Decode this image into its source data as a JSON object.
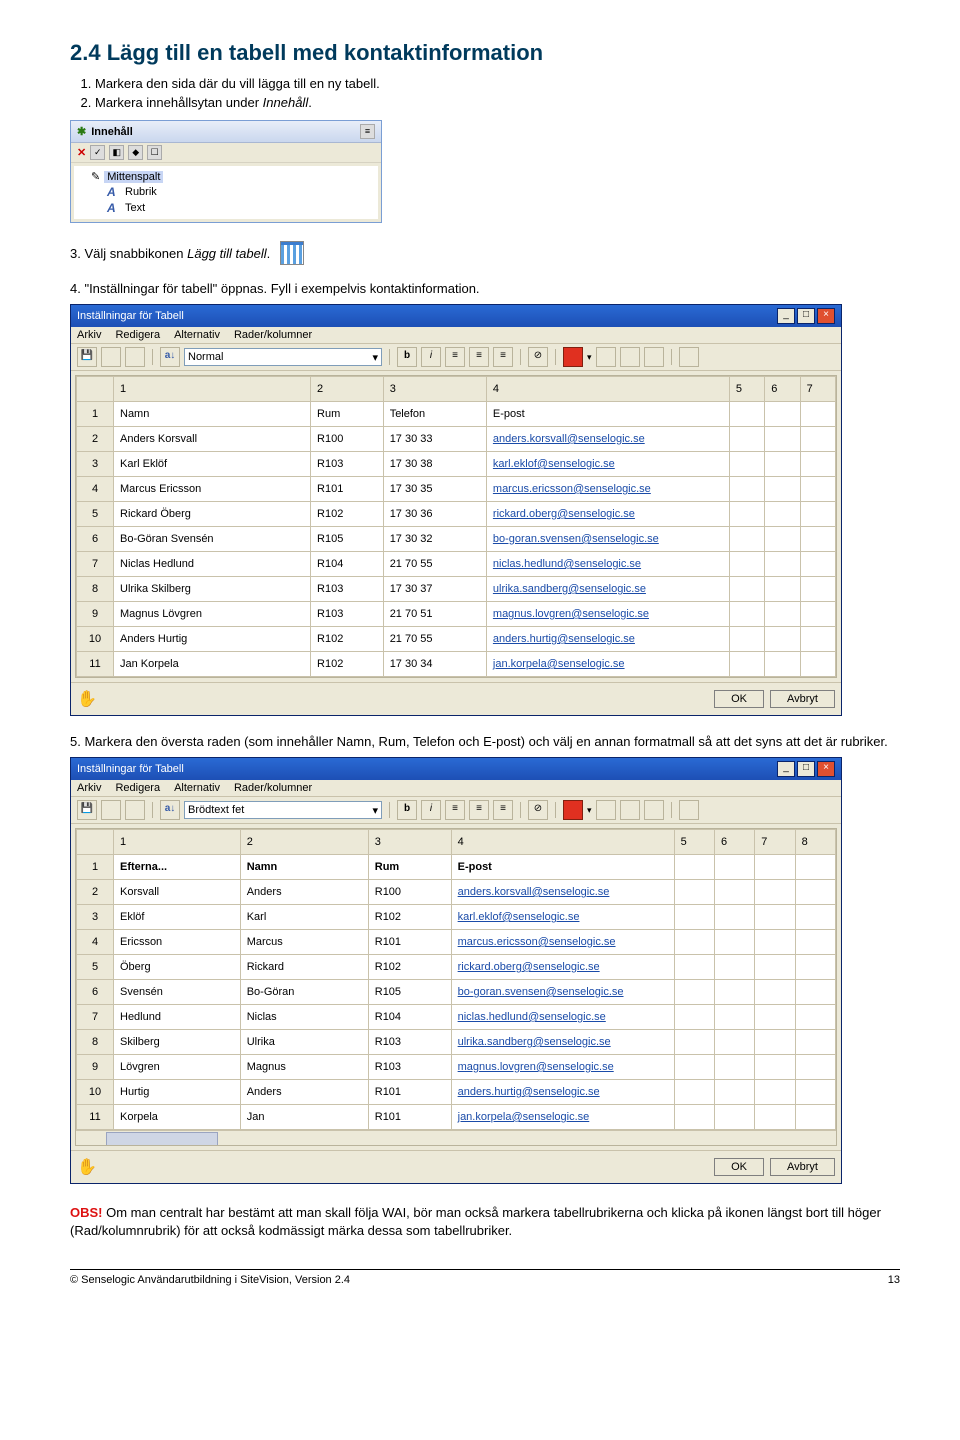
{
  "heading": "2.4  Lägg till en tabell med kontaktinformation",
  "steps": {
    "s1": "Markera den sida där du vill lägga till en ny tabell.",
    "s2_label": "Markera innehållsytan under",
    "s2_ital": "Innehåll",
    "s3_prefix": "3.  Välj snabbikonen",
    "s3_ital": "Lägg till tabell",
    "s3_dot": ".",
    "s4_prefix": "4.  \"Inställningar för tabell\" öppnas. Fyll i exempelvis kontaktinformation.",
    "s5": "Markera den översta raden (som innehåller Namn, Rum, Telefon och E-post) och välj en annan formatmall så att det syns att det är rubriker."
  },
  "panel": {
    "title": "Innehåll",
    "items": {
      "root": "Mittenspalt",
      "c1": "Rubrik",
      "c2": "Text"
    }
  },
  "dialog": {
    "title": "Inställningar för Tabell",
    "menu": [
      "Arkiv",
      "Redigera",
      "Alternativ",
      "Rader/kolumner"
    ],
    "style1": "Normal",
    "style2": "Brödtext fet",
    "ok": "OK",
    "cancel": "Avbryt",
    "col_nums1": [
      "1",
      "2",
      "3",
      "4",
      "5",
      "6",
      "7"
    ],
    "col_nums2": [
      "1",
      "2",
      "3",
      "4",
      "5",
      "6",
      "7",
      "8"
    ],
    "headers1": [
      "Namn",
      "Rum",
      "Telefon",
      "E-post"
    ],
    "headers2": [
      "Efterna...",
      "Namn",
      "Rum",
      "E-post"
    ],
    "rows1": [
      [
        "Anders Korsvall",
        "R100",
        "17 30 33",
        "anders.korsvall@senselogic.se"
      ],
      [
        "Karl Eklöf",
        "R103",
        "17 30 38",
        "karl.eklof@senselogic.se"
      ],
      [
        "Marcus Ericsson",
        "R101",
        "17 30 35",
        "marcus.ericsson@senselogic.se"
      ],
      [
        "Rickard Öberg",
        "R102",
        "17 30 36",
        "rickard.oberg@senselogic.se"
      ],
      [
        "Bo-Göran Svensén",
        "R105",
        "17 30 32",
        "bo-goran.svensen@senselogic.se"
      ],
      [
        "Niclas Hedlund",
        "R104",
        "21 70 55",
        "niclas.hedlund@senselogic.se"
      ],
      [
        "Ulrika Skilberg",
        "R103",
        "17 30 37",
        "ulrika.sandberg@senselogic.se"
      ],
      [
        "Magnus Lövgren",
        "R103",
        "21 70 51",
        "magnus.lovgren@senselogic.se"
      ],
      [
        "Anders Hurtig",
        "R102",
        "21 70 55",
        "anders.hurtig@senselogic.se"
      ],
      [
        "Jan Korpela",
        "R102",
        "17 30 34",
        "jan.korpela@senselogic.se"
      ]
    ],
    "rows2": [
      [
        "Korsvall",
        "Anders",
        "R100",
        "anders.korsvall@senselogic.se"
      ],
      [
        "Eklöf",
        "Karl",
        "R102",
        "karl.eklof@senselogic.se"
      ],
      [
        "Ericsson",
        "Marcus",
        "R101",
        "marcus.ericsson@senselogic.se"
      ],
      [
        "Öberg",
        "Rickard",
        "R102",
        "rickard.oberg@senselogic.se"
      ],
      [
        "Svensén",
        "Bo-Göran",
        "R105",
        "bo-goran.svensen@senselogic.se"
      ],
      [
        "Hedlund",
        "Niclas",
        "R104",
        "niclas.hedlund@senselogic.se"
      ],
      [
        "Skilberg",
        "Ulrika",
        "R103",
        "ulrika.sandberg@senselogic.se"
      ],
      [
        "Lövgren",
        "Magnus",
        "R103",
        "magnus.lovgren@senselogic.se"
      ],
      [
        "Hurtig",
        "Anders",
        "R101",
        "anders.hurtig@senselogic.se"
      ],
      [
        "Korpela",
        "Jan",
        "R101",
        "jan.korpela@senselogic.se"
      ]
    ]
  },
  "obs": {
    "label": "OBS!",
    "text": " Om man centralt har bestämt att man skall följa WAI, bör man också markera tabellrubrikerna och klicka på ikonen längst bort till höger (Rad/kolumnrubrik) för att också kodmässigt märka dessa som tabellrubriker."
  },
  "footer": {
    "left": "© Senselogic Användarutbildning i SiteVision, Version 2.4",
    "right": "13"
  }
}
